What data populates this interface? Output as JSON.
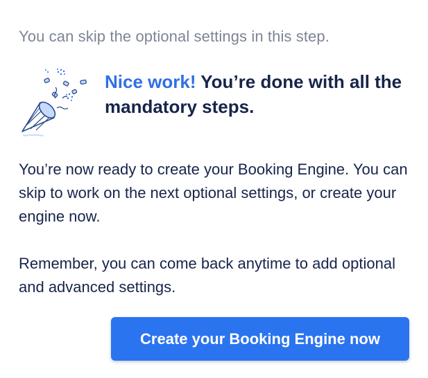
{
  "hint": "You can skip the optional settings in this step.",
  "headline": {
    "accent": "Nice work!",
    "rest": "You’re done with all the mandatory steps."
  },
  "illustration": {
    "icon": "party-popper-icon",
    "colors": {
      "outline": "#2a4a8c",
      "fill": "#c7dafc",
      "accent": "#2f6fe8"
    }
  },
  "paragraphs": {
    "ready": "You’re now ready to create your Booking Engine. You can skip to work on the next optional settings, or create your engine now.",
    "remember": "Remember, you can come back anytime to add optional and advanced settings."
  },
  "cta_label": "Create your Booking Engine now",
  "colors": {
    "accent": "#2f6fe8",
    "button": "#2b74f0",
    "text": "#17244a",
    "muted": "#7d8494"
  }
}
